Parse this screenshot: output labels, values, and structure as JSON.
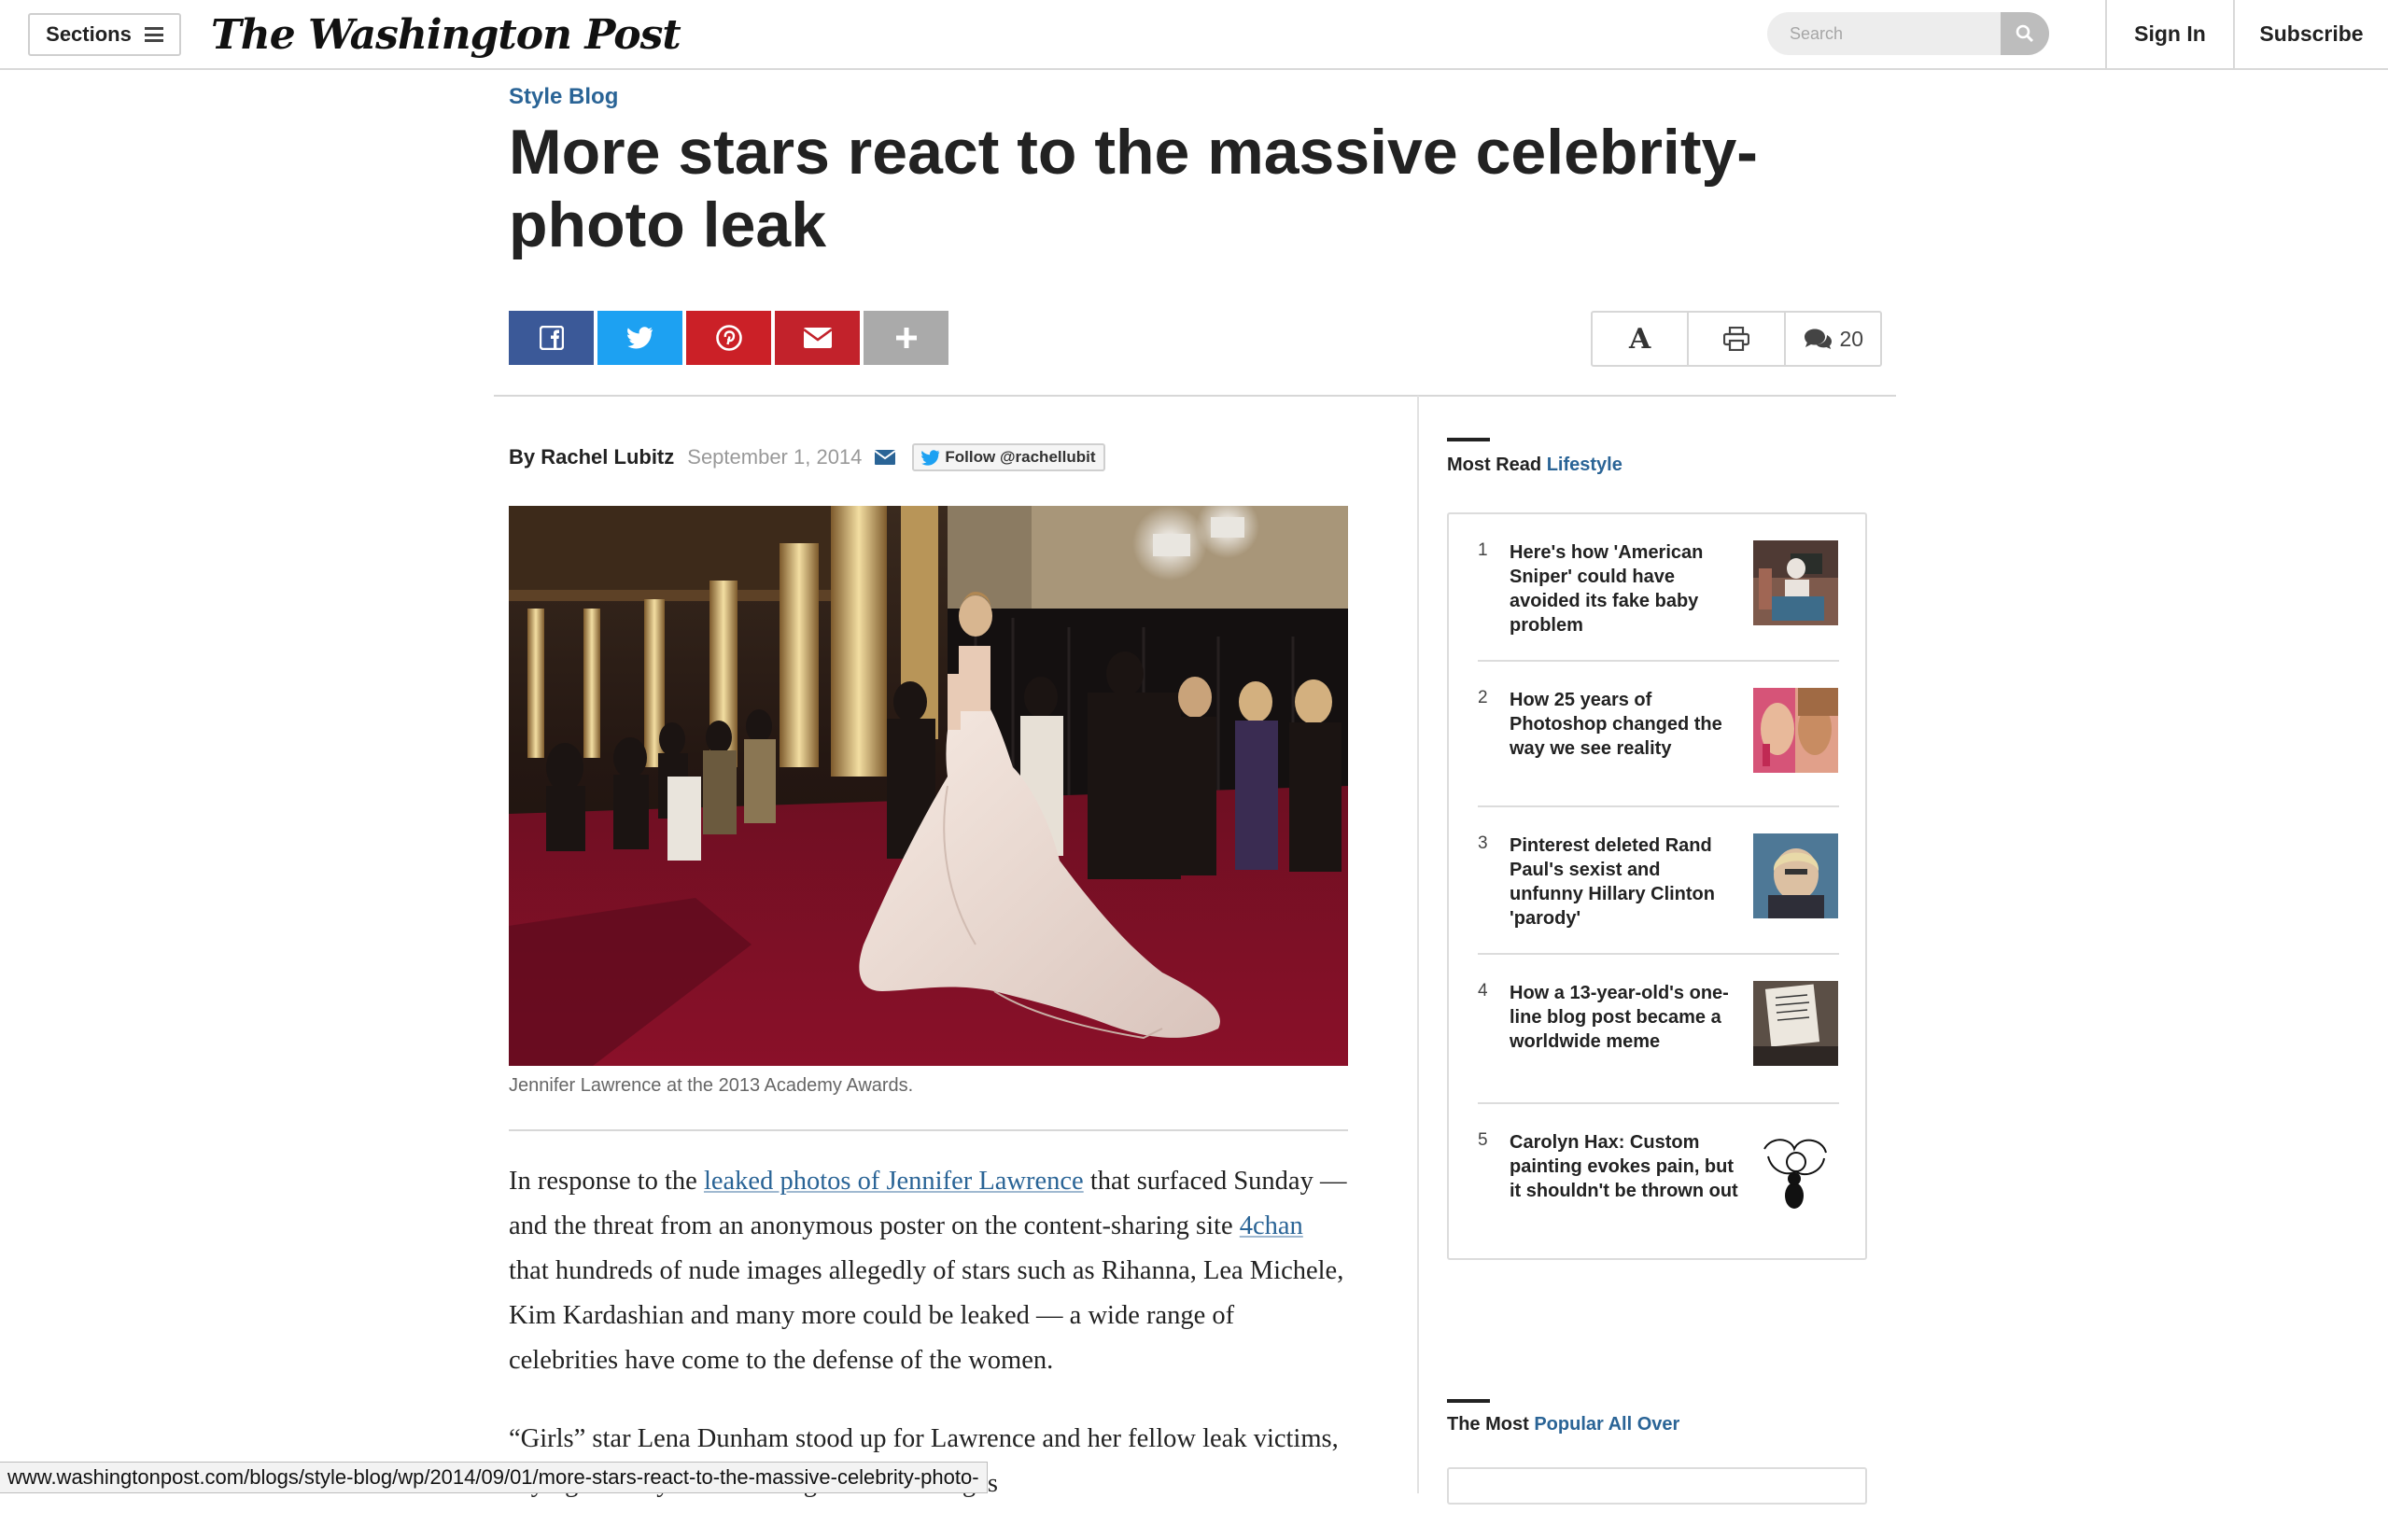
{
  "nav": {
    "sections_label": "Sections",
    "logo": "The Washington Post",
    "search_placeholder": "Search",
    "signin_label": "Sign In",
    "subscribe_label": "Subscribe"
  },
  "article": {
    "kicker": "Style Blog",
    "headline": "More stars react to the massive celebrity-photo leak",
    "comment_count": "20",
    "byline_prefix": "By",
    "author": "Rachel Lubitz",
    "date": "September 1, 2014",
    "follow_label": "Follow @rachellubit",
    "caption": "Jennifer Lawrence at the 2013 Academy Awards.",
    "p1_a": "In response to the ",
    "p1_link1": "leaked photos of Jennifer Lawrence",
    "p1_b": " that surfaced Sunday — and the threat from an anonymous poster on the content-sharing site ",
    "p1_link2": "4chan",
    "p1_c": " that hundreds of nude images allegedly of stars such as Rihanna, Lea Michele, Kim Kardashian and many more could be leaked — a wide range of celebrities have come to the defense of the women.",
    "p2": "“Girls” star Lena Dunham stood up for Lawrence and her fellow leak victims, saying that anyone searching for these images"
  },
  "sidebar": {
    "most_read_prefix": "Most Read",
    "most_read_accent": "Lifestyle",
    "items": [
      {
        "num": "1",
        "title": "Here's how 'American Sniper' could have avoided its fake baby problem"
      },
      {
        "num": "2",
        "title": "How 25 years of Photoshop changed the way we see reality"
      },
      {
        "num": "3",
        "title": "Pinterest deleted Rand Paul's sexist and unfunny Hillary Clinton 'parody'"
      },
      {
        "num": "4",
        "title": "How a 13-year-old's one-line blog post became a worldwide meme"
      },
      {
        "num": "5",
        "title": "Carolyn Hax: Custom painting evokes pain, but it shouldn't be thrown out"
      }
    ],
    "popular_prefix": "The Most",
    "popular_accent": "Popular All Over"
  },
  "status_url": "www.washingtonpost.com/blogs/style-blog/wp/2014/09/01/more-stars-react-to-the-massive-celebrity-photo-",
  "colors": {
    "link_blue": "#2a6496",
    "facebook": "#3b5998",
    "twitter": "#1da1f2",
    "pinterest": "#cb2027",
    "email": "#c2222b"
  }
}
